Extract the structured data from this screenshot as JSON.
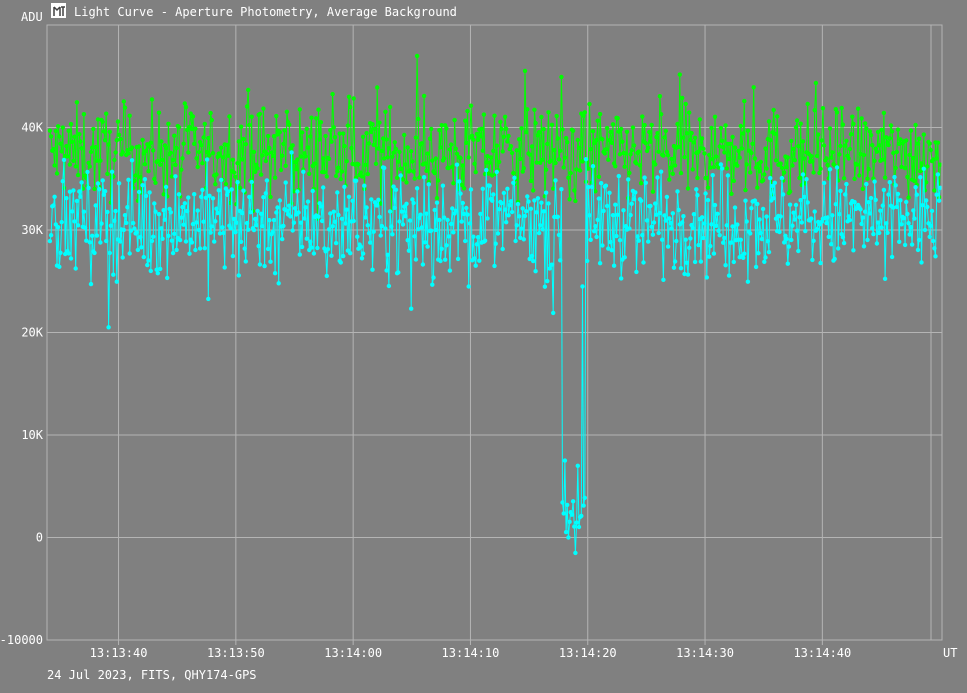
{
  "window": {
    "title": "Light Curve - Aperture Photometry, Average Background",
    "icon": "light-curve-app-icon"
  },
  "footer": {
    "caption": "24 Jul 2023, FITS, QHY174-GPS"
  },
  "colors": {
    "background": "#808080",
    "grid": "#b4b4b4",
    "text": "#ffffff",
    "series_target": "#00ffff",
    "series_comparison": "#00ff00"
  },
  "chart_data": {
    "type": "line",
    "markers": true,
    "title": "Light Curve - Aperture Photometry, Average Background",
    "ylabel": "ADU",
    "xlabel": "UT",
    "ylim": [
      -10000,
      50000
    ],
    "yticks": [
      -10000,
      0,
      10000,
      20000,
      30000,
      40000
    ],
    "ytick_labels": [
      "-10000",
      "0",
      "10K",
      "20K",
      "30K",
      "40K"
    ],
    "xlim": [
      "13:13:33.9",
      "13:14:50.2"
    ],
    "xticks": [
      "13:13:40",
      "13:13:50",
      "13:14:00",
      "13:14:10",
      "13:14:20",
      "13:14:30",
      "13:14:40"
    ],
    "grid": true,
    "legend": "none",
    "sampling_seconds": 0.1,
    "series": [
      {
        "color": "#00ff00",
        "samples": 760,
        "approx_mean": 37500,
        "approx_range": [
          27000,
          48000
        ]
      },
      {
        "color": "#00ffff",
        "samples": 760,
        "approx_mean": 31000,
        "approx_range": [
          -1500,
          40000
        ],
        "dip": {
          "start": "13:14:17.8",
          "end": "13:14:19.8",
          "min_value": -1500,
          "typical_value_in_dip": 3000
        },
        "notable_points": [
          {
            "x": "13:14:18.1",
            "y": 7500
          },
          {
            "x": "13:14:18.4",
            "y": 0
          },
          {
            "x": "13:14:19.0",
            "y": -1500
          },
          {
            "x": "13:14:19.2",
            "y": 7000
          },
          {
            "x": "13:14:19.6",
            "y": 24500
          }
        ]
      }
    ]
  }
}
